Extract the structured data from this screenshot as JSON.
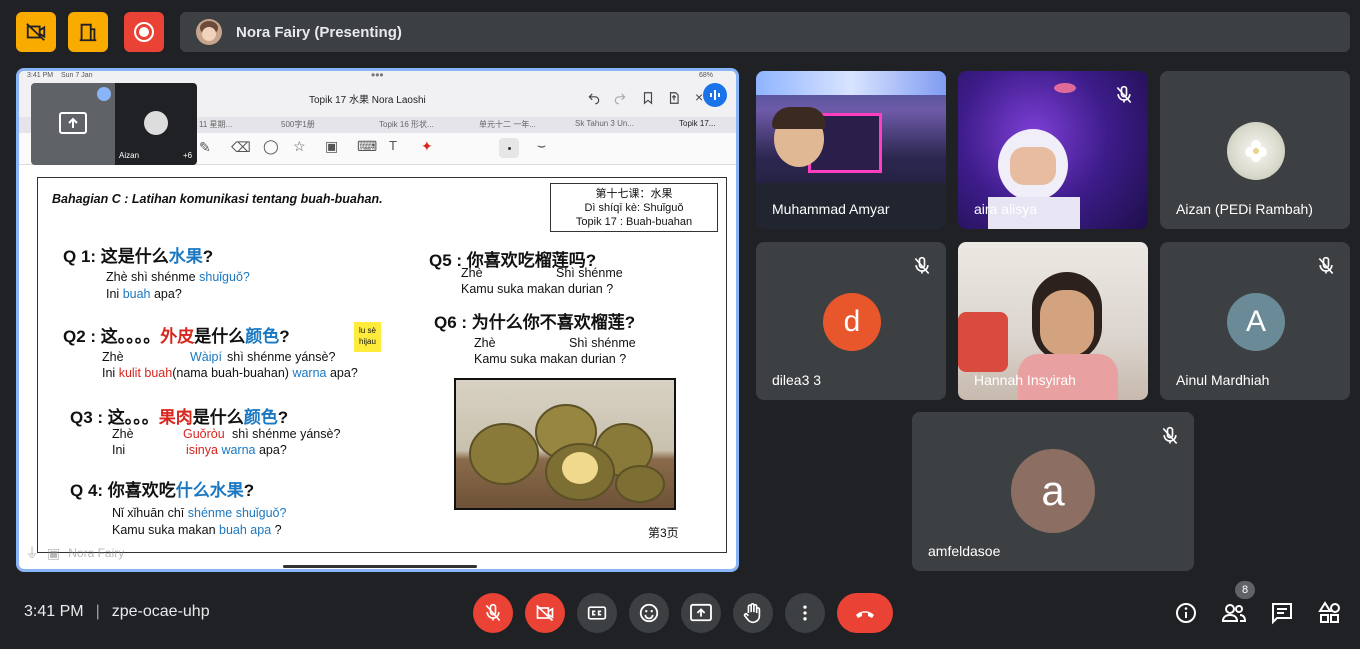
{
  "topbar": {
    "presenter_label": "Nora Fairy (Presenting)",
    "colors": {
      "yellow": "#f9ab00",
      "red": "#ea4335"
    }
  },
  "screen": {
    "status_time": "3:41 PM",
    "status_date": "Sun 7 Jan",
    "battery": "68%",
    "doc_title": "Topik 17 水果  Nora Laoshi",
    "tabs": [
      "11 星期...",
      "500字1册",
      "Topik 16 形状...",
      "单元十二 一年...",
      "Sk Tahun 3 Un...",
      "Topik 17..."
    ],
    "pip_label": "Aizan",
    "pip_count": "+6",
    "presenter_overlay": "Nora Fairy",
    "document": {
      "heading": "Bahagian C : Latihan komunikasi tentang buah-buahan.",
      "box_line1": "第十七课：水果",
      "box_line2": "Dì shíqī kè: Shuǐguǒ",
      "box_line3": "Topik  17 : Buah-buahan",
      "q1_prefix": "Q 1: 这是什么",
      "q1_blue": "水果",
      "q1_end": "?",
      "q1_py_a": "Zhè shì shénme",
      "q1_py_b": "shuǐguǒ?",
      "q1_ms_a": "Ini",
      "q1_ms_b": "buah",
      "q1_ms_c": "apa?",
      "q2_prefix": "Q2 : 这。。。。",
      "q2_red": "外皮",
      "q2_mid": "是什么",
      "q2_blue": "颜色",
      "q2_end": "?",
      "sticky": "lu sè\nhijau",
      "q2_py_a": "Zhè",
      "q2_py_b": "Wàipí",
      "q2_py_c": "shì shénme yánsè?",
      "q2_ms_a": "Ini",
      "q2_ms_b": "kulit buah",
      "q2_ms_c": "(nama buah-buahan)",
      "q2_ms_d": "warna",
      "q2_ms_e": "apa?",
      "q3_prefix": "Q3 : 这。。。",
      "q3_red": "果肉",
      "q3_mid": "是什么",
      "q3_blue": "颜色",
      "q3_end": "?",
      "q3_py_a": "Zhè",
      "q3_py_b": "Guǒròu",
      "q3_py_c": "shì shénme yánsè?",
      "q3_ms_a": "Ini",
      "q3_ms_b": "isinya",
      "q3_ms_c": "warna",
      "q3_ms_d": "apa?",
      "q4_prefix": "Q 4: 你喜欢吃",
      "q4_blue": "什么水果",
      "q4_end": "?",
      "q4_py_a": "Nǐ xǐhuān chī",
      "q4_py_b": "shénme shuǐguǒ?",
      "q4_ms_a": "Kamu suka makan",
      "q4_ms_b": "buah apa",
      "q4_ms_c": "?",
      "q5": "Q5 : 你喜欢吃榴莲吗?",
      "q5_py_a": "Zhè",
      "q5_py_b": "Shì shénme",
      "q5_ms": "Kamu suka makan durian  ?",
      "q6": "Q6 : 为什么你不喜欢榴莲?",
      "q6_py_a": "Zhè",
      "q6_py_b": "Shì shénme",
      "q6_ms": "Kamu suka makan durian  ?",
      "page": "第3页"
    }
  },
  "participants": [
    {
      "name": "Muhammad Amyar",
      "muted": false
    },
    {
      "name": "aira alisya",
      "muted": true
    },
    {
      "name": "Aizan (PEDi Rambah)",
      "muted": false
    },
    {
      "name": "dilea3 3",
      "initial": "d",
      "color": "#e8572b",
      "muted": true
    },
    {
      "name": "Hannah Insyirah",
      "muted": false
    },
    {
      "name": "Ainul Mardhiah",
      "initial": "A",
      "color": "#6b8a97",
      "muted": true
    },
    {
      "name": "amfeldasoe",
      "initial": "a",
      "color": "#8d6e63",
      "muted": true
    }
  ],
  "bottombar": {
    "time": "3:41 PM",
    "separator": "|",
    "meeting_code": "zpe-ocae-uhp",
    "people_count": "8"
  }
}
